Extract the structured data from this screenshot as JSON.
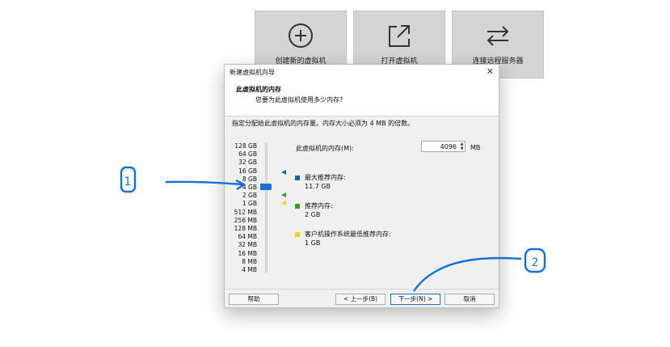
{
  "tiles": [
    {
      "label": "创建新的虚拟机",
      "icon": "plus-circle-icon"
    },
    {
      "label": "打开虚拟机",
      "icon": "open-external-icon"
    },
    {
      "label": "连接远程服务器",
      "icon": "swap-arrows-icon"
    }
  ],
  "dialog": {
    "title": "新建虚拟机向导",
    "close": "✕",
    "header_title": "此虚拟机的内存",
    "header_subtitle": "您要为此虚拟机使用多少内存?",
    "description": "指定分配给此虚拟机的内存量。内存大小必须为 4 MB 的倍数。",
    "scale_ticks": [
      "128 GB",
      "64 GB",
      "32 GB",
      "16 GB",
      "8 GB",
      "4 GB",
      "2 GB",
      "1 GB",
      "512 MB",
      "256 MB",
      "128 MB",
      "64 MB",
      "32 MB",
      "16 MB",
      "8 MB",
      "4 MB"
    ],
    "memory_label": "此虚拟机的内存(M):",
    "memory_value": "4096",
    "memory_unit": "MB",
    "max_label": "最大推荐内存:",
    "max_value": "11.7 GB",
    "rec_label": "推荐内存:",
    "rec_value": "2 GB",
    "min_label": "客户机操作系统最低推荐内存:",
    "min_value": "1 GB",
    "colors": {
      "max": "#1e5fb4",
      "rec": "#3a9a2a",
      "min": "#f2d21a",
      "accent": "#1e6fd0"
    },
    "buttons": {
      "help": "帮助",
      "back": "< 上一步(B)",
      "next": "下一步(N) >",
      "cancel": "取消"
    }
  },
  "annotations": {
    "one": "1",
    "two": "2",
    "color": "#1670d6"
  }
}
